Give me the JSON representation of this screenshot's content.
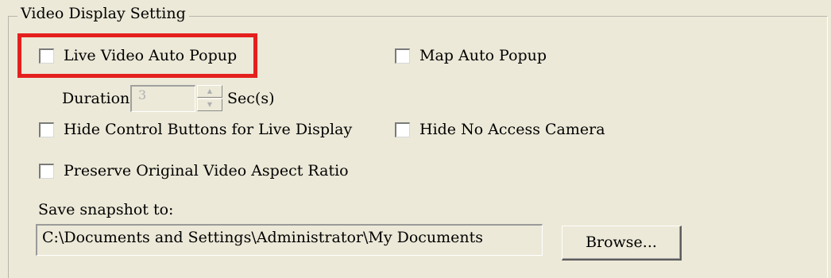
{
  "group": {
    "title": "Video Display Setting"
  },
  "options": {
    "live_video_auto_popup": {
      "label": "Live Video Auto Popup",
      "checked": false
    },
    "map_auto_popup": {
      "label": "Map Auto Popup",
      "checked": false
    },
    "hide_control_buttons": {
      "label": "Hide Control Buttons for Live Display",
      "checked": false
    },
    "hide_no_access_camera": {
      "label": "Hide No Access Camera",
      "checked": false
    },
    "preserve_aspect_ratio": {
      "label": "Preserve Original Video Aspect Ratio",
      "checked": false
    }
  },
  "duration": {
    "label": "Duration:",
    "value": "3",
    "unit": "Sec(s)",
    "enabled": false
  },
  "snapshot": {
    "label": "Save snapshot to:",
    "path": "C:\\Documents and Settings\\Administrator\\My Documents",
    "browse_label": "Browse..."
  },
  "annotation": {
    "highlight_color": "#e4201e"
  }
}
